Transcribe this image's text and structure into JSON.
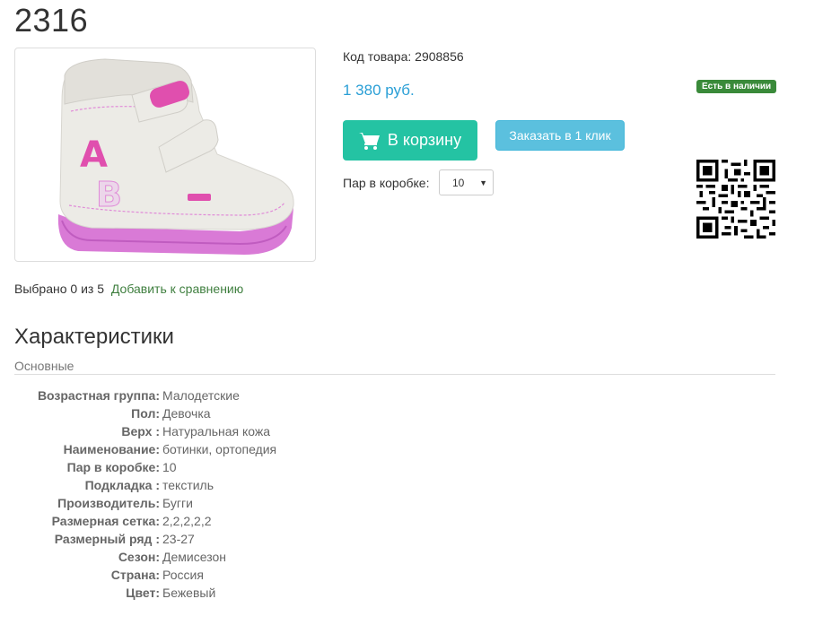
{
  "product": {
    "title": "2316",
    "sku_label": "Код товара:",
    "sku_value": "2908856",
    "price": "1 380 руб.",
    "stock_badge": "Есть в наличии",
    "image_letters": [
      "A",
      "B"
    ]
  },
  "actions": {
    "cart_button": "В корзину",
    "oneclick_button": "Заказать в 1 клик",
    "pairs_label": "Пар в коробке:",
    "pairs_selected": "10"
  },
  "compare": {
    "selected_text": "Выбрано 0 из 5",
    "link_text": "Добавить к сравнению"
  },
  "specs": {
    "title": "Характеристики",
    "group": "Основные",
    "rows": [
      {
        "key": "Возрастная группа:",
        "value": "Малодетские"
      },
      {
        "key": "Пол:",
        "value": "Девочка"
      },
      {
        "key": "Верх :",
        "value": "Натуральная кожа"
      },
      {
        "key": "Наименование:",
        "value": "ботинки, ортопедия"
      },
      {
        "key": "Пар в коробке:",
        "value": "10"
      },
      {
        "key": "Подкладка :",
        "value": "текстиль"
      },
      {
        "key": "Производитель:",
        "value": "Бугги"
      },
      {
        "key": "Размерная сетка:",
        "value": "2,2,2,2,2"
      },
      {
        "key": "Размерный ряд :",
        "value": "23-27"
      },
      {
        "key": "Сезон:",
        "value": "Демисезон"
      },
      {
        "key": "Страна:",
        "value": "Россия"
      },
      {
        "key": "Цвет:",
        "value": "Бежевый"
      }
    ]
  },
  "colors": {
    "price": "#2a9fd6",
    "cart_button": "#24c3a3",
    "oneclick_button": "#5bc0de",
    "stock_badge": "#3a8a3a",
    "compare_link": "#3f7f3f"
  }
}
